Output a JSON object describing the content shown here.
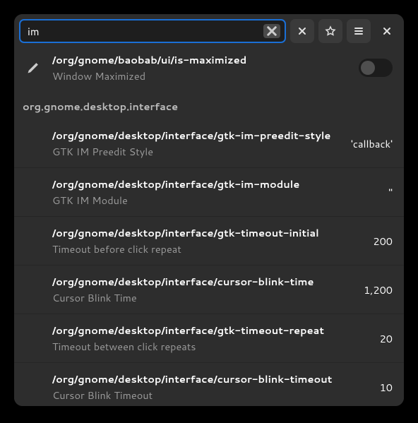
{
  "search": {
    "value": "im"
  },
  "first_row": {
    "path": "/org/gnome/baobab/ui/is-maximized",
    "desc": "Window Maximized"
  },
  "group": {
    "label": "org.gnome.desktop.interface"
  },
  "rows": [
    {
      "path": "/org/gnome/desktop/interface/gtk-im-preedit-style",
      "desc": "GTK IM Preedit Style",
      "value": "'callback'"
    },
    {
      "path": "/org/gnome/desktop/interface/gtk-im-module",
      "desc": "GTK IM Module",
      "value": "''"
    },
    {
      "path": "/org/gnome/desktop/interface/gtk-timeout-initial",
      "desc": "Timeout before click repeat",
      "value": "200"
    },
    {
      "path": "/org/gnome/desktop/interface/cursor-blink-time",
      "desc": "Cursor Blink Time",
      "value": "1,200"
    },
    {
      "path": "/org/gnome/desktop/interface/gtk-timeout-repeat",
      "desc": "Timeout between click repeats",
      "value": "20"
    },
    {
      "path": "/org/gnome/desktop/interface/cursor-blink-timeout",
      "desc": "Cursor Blink Timeout",
      "value": "10"
    }
  ]
}
